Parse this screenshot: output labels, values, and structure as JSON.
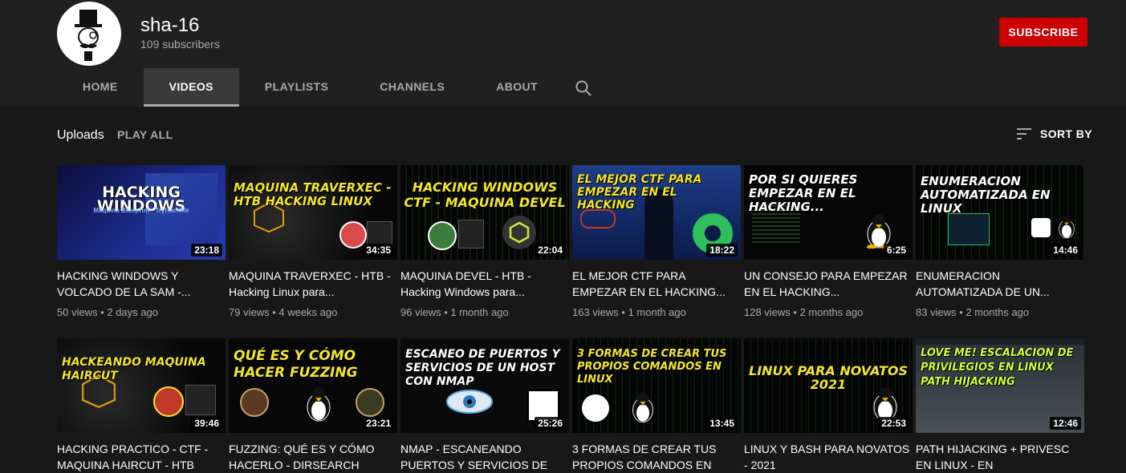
{
  "channel": {
    "name": "sha-16",
    "subscribers": "109 subscribers",
    "subscribe_label": "SUBSCRIBE"
  },
  "tabs": [
    {
      "label": "HOME"
    },
    {
      "label": "VIDEOS"
    },
    {
      "label": "PLAYLISTS"
    },
    {
      "label": "CHANNELS"
    },
    {
      "label": "ABOUT"
    }
  ],
  "uploads": {
    "title": "Uploads",
    "play_all": "PLAY ALL",
    "sort_by": "SORT BY"
  },
  "colors": {
    "background": "#181818",
    "header": "#202020",
    "subscribe": "#cc0000",
    "thumb_title_yellow": "#f4e72a"
  },
  "videos": [
    {
      "thumb_text": "HACKING WINDOWS",
      "thumb_sub": "Máquina Blueprint - TryHackMe",
      "duration": "23:18",
      "title": "HACKING WINDOWS Y VOLCADO DE LA SAM -...",
      "views": "50 views",
      "age": "2 days ago"
    },
    {
      "thumb_text": "MAQUINA TRAVERXEC - HTB HACKING LINUX",
      "duration": "34:35",
      "title": "MAQUINA TRAVERXEC - HTB - Hacking Linux para...",
      "views": "79 views",
      "age": "4 weeks ago"
    },
    {
      "thumb_text": "HACKING WINDOWS CTF - MAQUINA DEVEL",
      "duration": "22:04",
      "title": "MAQUINA DEVEL - HTB - Hacking Windows para...",
      "views": "96 views",
      "age": "1 month ago"
    },
    {
      "thumb_text": "EL MEJOR CTF PARA EMPEZAR EN EL HACKING",
      "duration": "18:22",
      "title": "EL MEJOR CTF PARA EMPEZAR EN EL HACKING...",
      "views": "163 views",
      "age": "1 month ago"
    },
    {
      "thumb_text": "POR SI QUIERES EMPEZAR EN EL HACKING...",
      "duration": "6:25",
      "title": "UN CONSEJO PARA EMPEZAR EN EL HACKING...",
      "views": "128 views",
      "age": "2 months ago"
    },
    {
      "thumb_text": "ENUMERACION AUTOMATIZADA EN LINUX",
      "duration": "14:46",
      "title": "ENUMERACION AUTOMATIZADA DE UN...",
      "views": "83 views",
      "age": "2 months ago"
    },
    {
      "thumb_text": "HACKEANDO MAQUINA HAIRCUT",
      "duration": "39:46",
      "title": "HACKING PRACTICO - CTF - MAQUINA HAIRCUT - HTB",
      "views": "",
      "age": ""
    },
    {
      "thumb_text": "QUÉ ES Y CÓMO HACER FUZZING",
      "duration": "23:21",
      "title": "FUZZING: QUÉ ES Y CÓMO HACERLO - DIRSEARCH",
      "views": "",
      "age": ""
    },
    {
      "thumb_text": "ESCANEO DE PUERTOS Y SERVICIOS DE UN HOST CON NMAP",
      "duration": "25:26",
      "title": "NMAP - ESCANEANDO PUERTOS Y SERVICIOS DE",
      "views": "",
      "age": ""
    },
    {
      "thumb_text": "3 FORMAS DE CREAR TUS PROPIOS COMANDOS EN LINUX",
      "duration": "13:45",
      "title": "3 FORMAS DE CREAR TUS PROPIOS COMANDOS EN",
      "views": "",
      "age": ""
    },
    {
      "thumb_text": "LINUX PARA NOVATOS 2021",
      "duration": "22:53",
      "title": "LINUX Y BASH PARA NOVATOS - 2021",
      "views": "",
      "age": ""
    },
    {
      "thumb_text": "LOVE ME! ESCALACION DE PRIVILEGIOS EN LINUX PATH HIJACKING",
      "duration": "12:46",
      "title": "PATH HIJACKING + PRIVESC EN LINUX - EN",
      "views": "",
      "age": ""
    }
  ]
}
